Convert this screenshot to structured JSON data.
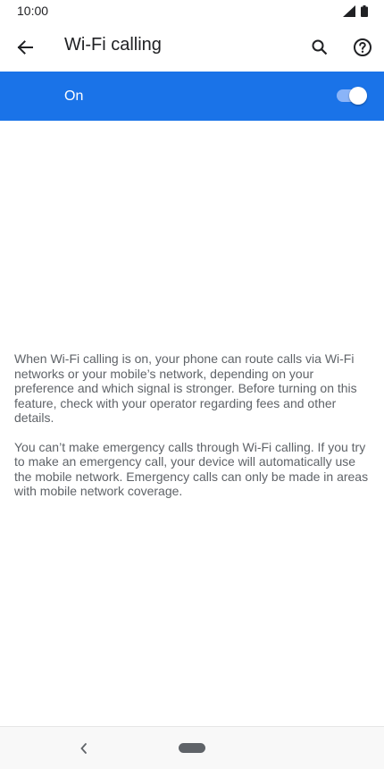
{
  "status_bar": {
    "time": "10:00",
    "icons": [
      "signal-icon",
      "battery-icon"
    ]
  },
  "app_bar": {
    "title": "Wi-Fi calling",
    "icons": [
      "back-arrow-icon",
      "search-icon",
      "help-icon"
    ]
  },
  "toggle": {
    "label": "On",
    "state": "on"
  },
  "description": {
    "paragraph_1": "When Wi-Fi calling is on, your phone can route calls via Wi-Fi networks or your mobile’s network, depending on your preference and which signal is stronger. Before turning on this feature, check with your operator regarding fees and other details.",
    "paragraph_2": "You can’t make emergency calls through Wi-Fi calling. If you try to make an emergency call, your device will automatically use the mobile network. Emergency calls can only be made in areas with mobile network coverage."
  },
  "nav_bar": {
    "icons": [
      "nav-back-icon",
      "home-pill-icon"
    ]
  },
  "colors": {
    "accent": "#1a73e8",
    "switch_track": "#8ab4f8",
    "body_text": "#5f6368",
    "title_text": "#202124"
  }
}
